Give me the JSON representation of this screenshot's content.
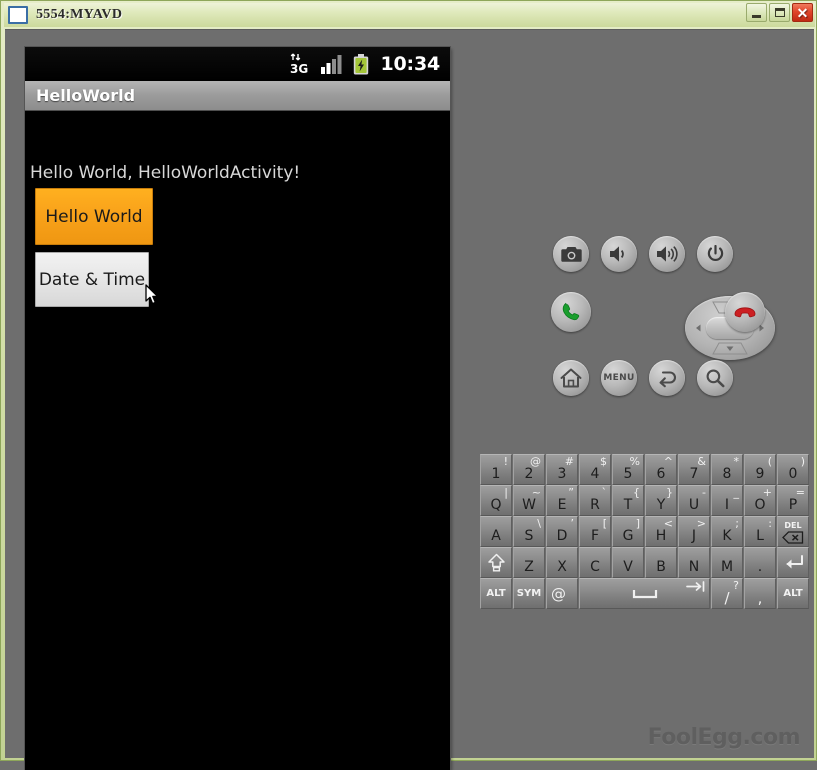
{
  "window": {
    "title": "5554:MYAVD",
    "icon": "window-icon",
    "controls": [
      {
        "name": "minimize",
        "glyph": "minimize-icon"
      },
      {
        "name": "maximize",
        "glyph": "maximize-icon"
      },
      {
        "name": "close",
        "glyph": "✕"
      }
    ]
  },
  "status_bar": {
    "network_label": "3G",
    "clock": "10:34",
    "icons": [
      "data-3g-icon",
      "signal-bars-icon",
      "battery-charging-icon"
    ],
    "battery_color": "#a4c639",
    "signal_bars": 4
  },
  "app": {
    "title": "HelloWorld",
    "hello_text": "Hello World, HelloWorldActivity!",
    "buttons": [
      {
        "label": "Hello World",
        "state": "focused",
        "color": "#f9a21a"
      },
      {
        "label": "Date & Time",
        "state": "normal",
        "color": "#e6e6e6"
      }
    ]
  },
  "controls": {
    "row1": [
      {
        "name": "camera-button",
        "icon": "camera-icon"
      },
      {
        "name": "volume-down-button",
        "icon": "volume-down-icon"
      },
      {
        "name": "volume-up-button",
        "icon": "volume-up-icon"
      },
      {
        "name": "power-button",
        "icon": "power-icon"
      }
    ],
    "row2": [
      {
        "name": "call-button",
        "icon": "phone-green-icon"
      },
      {
        "name": "dpad",
        "icon": "dpad-icon"
      },
      {
        "name": "end-call-button",
        "icon": "phone-red-icon"
      }
    ],
    "row3": [
      {
        "name": "home-button",
        "icon": "home-icon",
        "label": ""
      },
      {
        "name": "menu-button",
        "icon": "menu-icon",
        "label": "MENU"
      },
      {
        "name": "back-button",
        "icon": "back-arrow-icon",
        "label": ""
      },
      {
        "name": "search-button",
        "icon": "search-icon",
        "label": ""
      }
    ]
  },
  "keyboard": {
    "rows": [
      [
        {
          "main": "1",
          "alt": "!"
        },
        {
          "main": "2",
          "alt": "@"
        },
        {
          "main": "3",
          "alt": "#"
        },
        {
          "main": "4",
          "alt": "$"
        },
        {
          "main": "5",
          "alt": "%"
        },
        {
          "main": "6",
          "alt": "^"
        },
        {
          "main": "7",
          "alt": "&"
        },
        {
          "main": "8",
          "alt": "*"
        },
        {
          "main": "9",
          "alt": "("
        },
        {
          "main": "0",
          "alt": ")"
        }
      ],
      [
        {
          "main": "Q",
          "alt": "|"
        },
        {
          "main": "W",
          "alt": "~"
        },
        {
          "main": "E",
          "alt": "”"
        },
        {
          "main": "R",
          "alt": "`"
        },
        {
          "main": "T",
          "alt": "{"
        },
        {
          "main": "Y",
          "alt": "}"
        },
        {
          "main": "U",
          "alt": "-"
        },
        {
          "main": "I",
          "alt": "_"
        },
        {
          "main": "O",
          "alt": "+"
        },
        {
          "main": "P",
          "alt": "="
        }
      ],
      [
        {
          "main": "A",
          "alt": ""
        },
        {
          "main": "S",
          "alt": "\\"
        },
        {
          "main": "D",
          "alt": "’"
        },
        {
          "main": "F",
          "alt": "["
        },
        {
          "main": "G",
          "alt": "]"
        },
        {
          "main": "H",
          "alt": "<"
        },
        {
          "main": "J",
          "alt": ">"
        },
        {
          "main": "K",
          "alt": ";"
        },
        {
          "main": "L",
          "alt": ":"
        },
        {
          "main": "DEL",
          "alt": "",
          "type": "delete"
        }
      ],
      [
        {
          "main": "",
          "alt": "",
          "type": "shift"
        },
        {
          "main": "Z",
          "alt": ""
        },
        {
          "main": "X",
          "alt": ""
        },
        {
          "main": "C",
          "alt": ""
        },
        {
          "main": "V",
          "alt": ""
        },
        {
          "main": "B",
          "alt": ""
        },
        {
          "main": "N",
          "alt": ""
        },
        {
          "main": "M",
          "alt": ""
        },
        {
          "main": ".",
          "alt": ""
        },
        {
          "main": "",
          "alt": "",
          "type": "enter"
        }
      ],
      [
        {
          "main": "ALT",
          "alt": "",
          "type": "mod"
        },
        {
          "main": "SYM",
          "alt": "",
          "type": "mod"
        },
        {
          "main": "@",
          "alt": "",
          "type": "symlight"
        },
        {
          "main": "",
          "alt": "",
          "type": "space"
        },
        {
          "main": "/",
          "alt": "?"
        },
        {
          "main": ",",
          "alt": ""
        },
        {
          "main": "ALT",
          "alt": "",
          "type": "mod"
        }
      ]
    ]
  },
  "watermark": "FoolEgg.com"
}
